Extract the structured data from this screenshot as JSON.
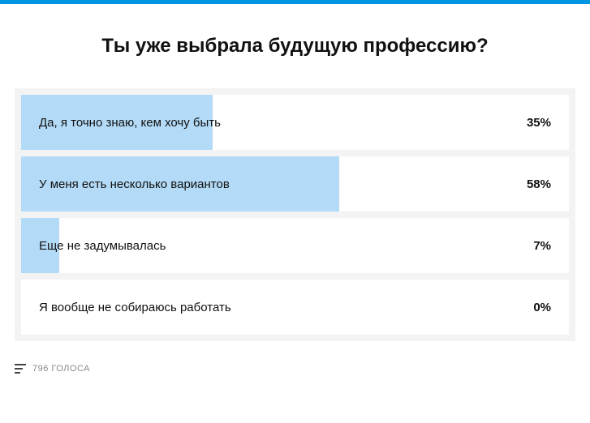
{
  "title": "Ты уже выбрала будущую профессию?",
  "options": [
    {
      "label": "Да, я точно знаю, кем хочу быть",
      "percent": "35%",
      "width": "35%"
    },
    {
      "label": "У меня есть несколько вариантов",
      "percent": "58%",
      "width": "58%"
    },
    {
      "label": "Еще не задумывалась",
      "percent": "7%",
      "width": "7%"
    },
    {
      "label": "Я вообще не собираюсь работать",
      "percent": "0%",
      "width": "0%"
    }
  ],
  "footer": {
    "votes": "796 ГОЛОСА"
  },
  "chart_data": {
    "type": "bar",
    "title": "Ты уже выбрала будущую профессию?",
    "categories": [
      "Да, я точно знаю, кем хочу быть",
      "У меня есть несколько вариантов",
      "Еще не задумывалась",
      "Я вообще не собираюсь работать"
    ],
    "values": [
      35,
      58,
      7,
      0
    ],
    "unit": "%",
    "total_votes": 796,
    "xlabel": "",
    "ylabel": "",
    "ylim": [
      0,
      100
    ]
  }
}
